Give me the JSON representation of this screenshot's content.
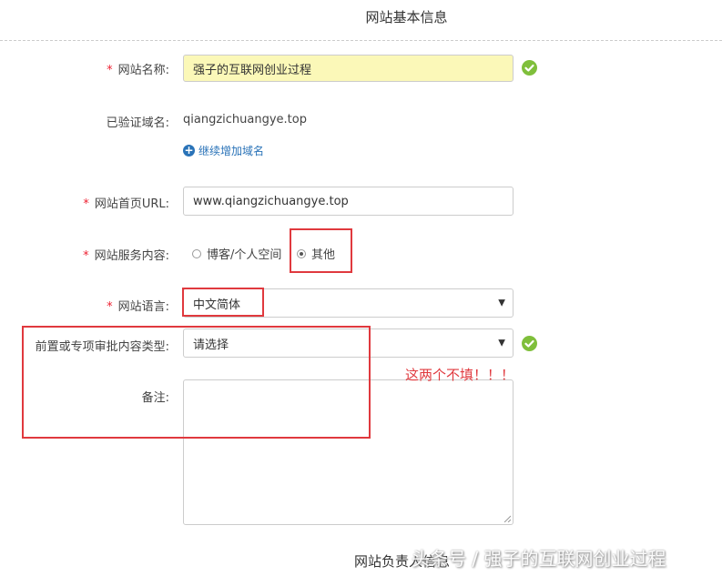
{
  "page": {
    "title": "网站基本信息",
    "bottom_heading": "网站负责人信息"
  },
  "form": {
    "site_name": {
      "label": "网站名称:",
      "value": "强子的互联网创业过程"
    },
    "verified_domain": {
      "label": "已验证域名:",
      "value": "qiangzichuangye.top",
      "add_link": "继续增加域名"
    },
    "homepage_url": {
      "label": "网站首页URL:",
      "value": "www.qiangzichuangye.top"
    },
    "service_content": {
      "label": "网站服务内容:",
      "options": [
        "博客/个人空间",
        "其他"
      ],
      "selected": "其他"
    },
    "language": {
      "label": "网站语言:",
      "value": "中文简体"
    },
    "pre_approval": {
      "label": "前置或专项审批内容类型:",
      "value": "请选择"
    },
    "remarks": {
      "label": "备注:",
      "value": ""
    },
    "required_mark": "*"
  },
  "annotation": {
    "text": "这两个不填！！！"
  },
  "watermark": {
    "text": "头条号 / 强子的互联网创业过程"
  },
  "colors": {
    "accent_blue": "#2a73b8",
    "ok_green": "#7fbf3b",
    "annotation_red": "#e0393e",
    "highlight_yellow": "#fbf8b8"
  }
}
